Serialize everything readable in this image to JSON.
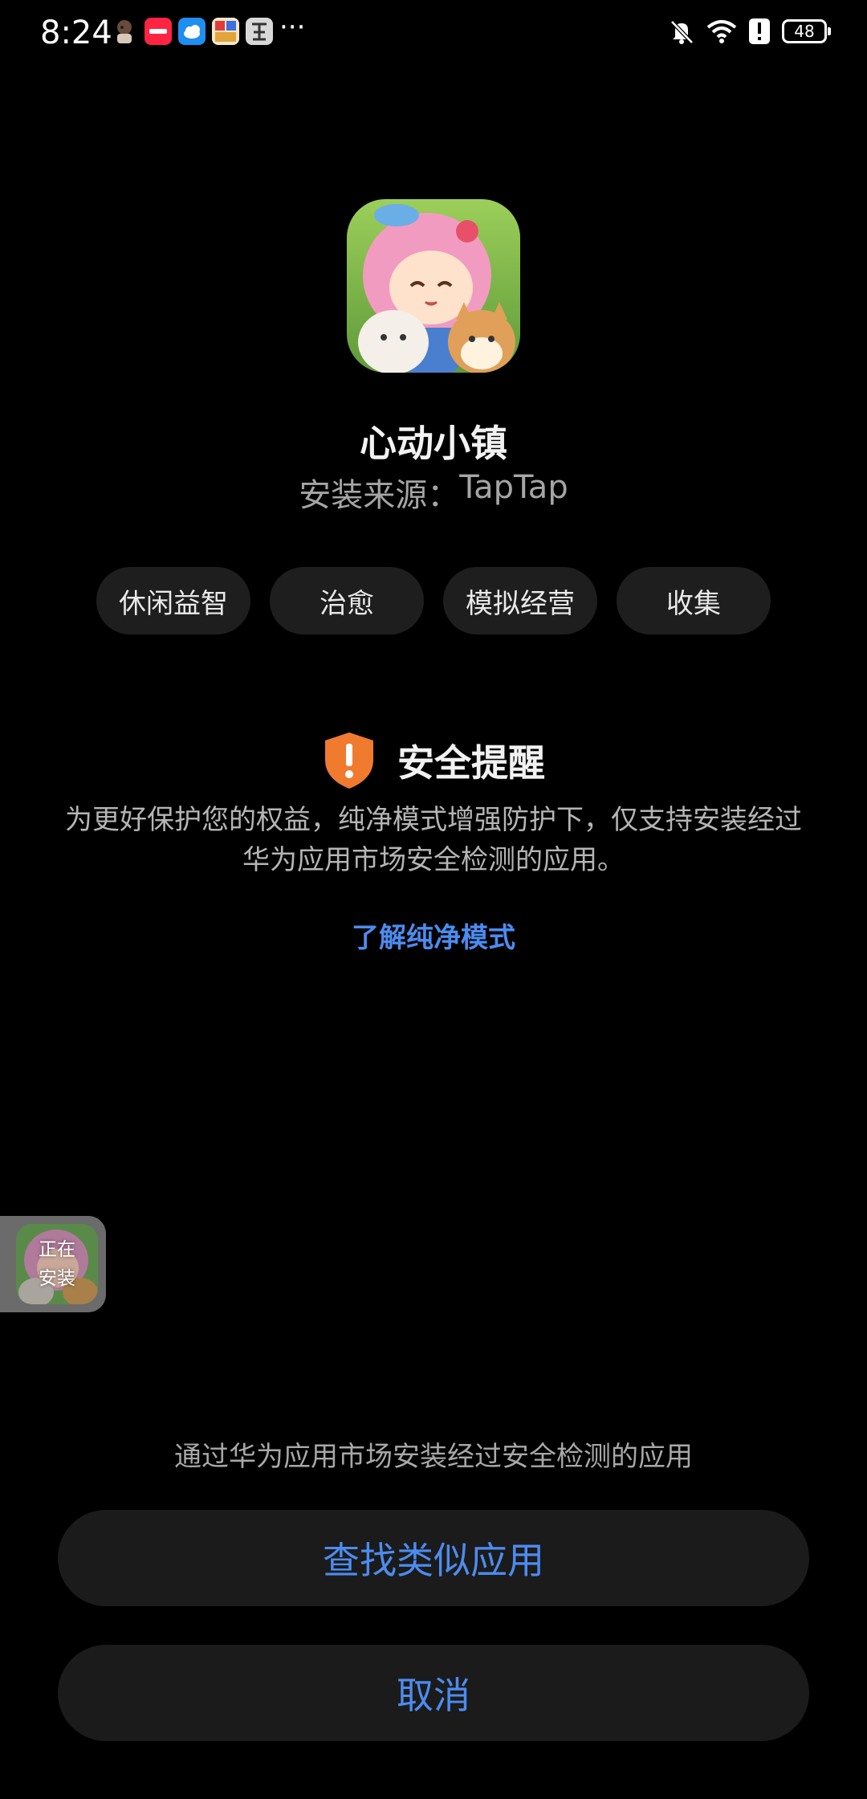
{
  "status_bar": {
    "time": "8:24",
    "battery": "48",
    "more": "···",
    "notification_icons": [
      "game-avatar-icon",
      "xiaohongshu-icon",
      "weather-icon",
      "game-app-icon",
      "calligraphy-app-icon"
    ],
    "system_icons": [
      "bell-off-icon",
      "wifi-icon",
      "alert-icon",
      "battery-icon"
    ]
  },
  "app": {
    "name": "心动小镇",
    "source_label": "安装来源：",
    "source_value": "TapTap"
  },
  "tags": [
    "休闲益智",
    "治愈",
    "模拟经营",
    "收集"
  ],
  "security": {
    "title": "安全提醒",
    "body": "为更好保护您的权益，纯净模式增强防护下，仅支持安装经过华为应用市场安全检测的应用。",
    "learn_more": "了解纯净模式"
  },
  "install_float": {
    "line1": "正在",
    "line2": "安装"
  },
  "bottom": {
    "hint": "通过华为应用市场安装经过安全检测的应用",
    "find_similar": "查找类似应用",
    "cancel": "取消"
  },
  "colors": {
    "accent": "#4c8cf0",
    "warning": "#f07a2e",
    "background": "#000000",
    "button_bg": "#1b1b1b",
    "tag_bg": "#1e1e1e"
  }
}
